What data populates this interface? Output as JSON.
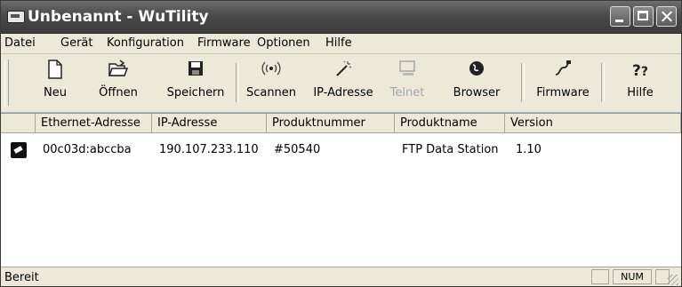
{
  "window": {
    "title": "Unbenannt - WuTility"
  },
  "menu": [
    "Datei",
    "Gerät",
    "Konfiguration",
    "Firmware",
    "Optionen",
    "Hilfe"
  ],
  "toolbar": {
    "new": {
      "label": "Neu",
      "icon": "page-icon"
    },
    "open": {
      "label": "Öffnen",
      "icon": "folder-open-icon"
    },
    "save": {
      "label": "Speichern",
      "icon": "floppy-disk-icon"
    },
    "scan": {
      "label": "Scannen",
      "icon": "antenna-icon"
    },
    "ipaddress": {
      "label": "IP-Adresse",
      "icon": "magic-wand-icon"
    },
    "telnet": {
      "label": "Telnet",
      "icon": "terminal-icon",
      "enabled": false
    },
    "browser": {
      "label": "Browser",
      "icon": "globe-icon"
    },
    "firmware": {
      "label": "Firmware",
      "icon": "cable-plug-icon"
    },
    "help": {
      "label": "Hilfe",
      "icon": "help-icon"
    }
  },
  "table": {
    "columns": [
      "Ethernet-Adresse",
      "IP-Adresse",
      "Produktnummer",
      "Produktname",
      "Version"
    ],
    "rows": [
      {
        "ethernet": "00c03d:abccba",
        "ip": "190.107.233.110",
        "product_number": "#50540",
        "product_name": "FTP Data Station",
        "version": "1.10"
      }
    ]
  },
  "status": {
    "text": "Bereit",
    "num": "NUM"
  }
}
